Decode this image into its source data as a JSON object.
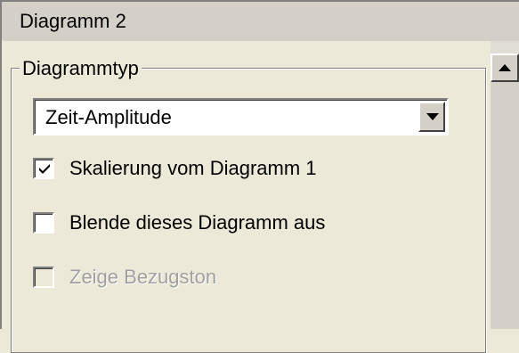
{
  "panel_title": "Diagramm 2",
  "group": {
    "legend": "Diagrammtyp"
  },
  "combo": {
    "selected": "Zeit-Amplitude"
  },
  "checkboxes": [
    {
      "label": "Skalierung vom Diagramm 1",
      "checked": true,
      "enabled": true
    },
    {
      "label": "Blende dieses Diagramm aus",
      "checked": false,
      "enabled": true
    },
    {
      "label": "Zeige Bezugston",
      "checked": false,
      "enabled": false
    }
  ],
  "icons": {
    "combo_arrow": "chevron-down-icon",
    "scroll_up": "arrow-up-icon"
  },
  "colors": {
    "background": "#ece9d8",
    "title_bar": "#d4d0c8",
    "disabled_text": "#a0a0a0"
  }
}
